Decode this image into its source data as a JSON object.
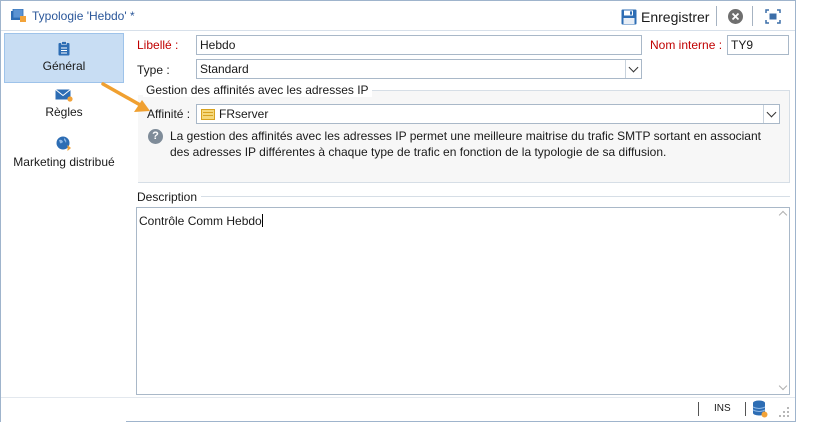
{
  "window": {
    "title": "Typologie 'Hebdo' *"
  },
  "toolbar": {
    "save_label": "Enregistrer"
  },
  "sidebar": {
    "items": [
      {
        "label": "Général",
        "icon": "clipboard-icon",
        "selected": true
      },
      {
        "label": "Règles",
        "icon": "envelope-icon",
        "selected": false
      },
      {
        "label": "Marketing distribué",
        "icon": "globe-icon",
        "selected": false
      }
    ]
  },
  "form": {
    "libelle_label": "Libellé :",
    "libelle_value": "Hebdo",
    "nom_interne_label": "Nom interne :",
    "nom_interne_value": "TY9",
    "type_label": "Type :",
    "type_value": "Standard",
    "ip_group_title": "Gestion des affinités avec les adresses IP",
    "affinite_label": "Affinité :",
    "affinite_value": "FRserver",
    "info_text": "La gestion des affinités avec les adresses IP permet une meilleure maitrise du trafic SMTP sortant en associant des adresses IP différentes à chaque type de trafic en fonction de la typologie de sa diffusion.",
    "description_label": "Description",
    "description_value": "Contrôle Comm Hebdo"
  },
  "statusbar": {
    "mode": "INS"
  },
  "colors": {
    "title_text": "#2b579a",
    "required_label": "#c00000",
    "selected_nav_bg": "#c8ddf3",
    "annotation_arrow": "#f0a030"
  }
}
